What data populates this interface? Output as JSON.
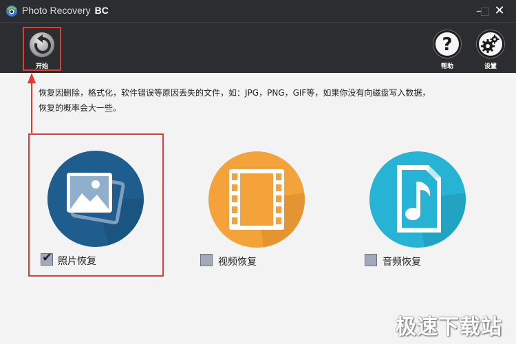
{
  "window": {
    "title": "Photo Recovery",
    "title_suffix": "BC",
    "minimize": "–",
    "maximize": "□",
    "close": "✕"
  },
  "toolbar": {
    "start_label": "开始",
    "help_label": "帮助",
    "settings_label": "设置"
  },
  "description": {
    "line1": "恢复因删除，格式化，软件错误等原因丢失的文件，如：JPG，PNG，GIF等，如果你没有向磁盘写入数据，",
    "line2": "恢复的概率会大一些。"
  },
  "categories": [
    {
      "label": "照片恢复",
      "checked": true,
      "icon": "photo-icon",
      "color": "#1e5d8e"
    },
    {
      "label": "视频恢复",
      "checked": false,
      "icon": "film-icon",
      "color": "#f3a33a"
    },
    {
      "label": "音频恢复",
      "checked": false,
      "icon": "music-file-icon",
      "color": "#26b3d4"
    }
  ],
  "watermark": "极速下载站",
  "colors": {
    "titlebar": "#2b2d30",
    "highlight": "#e23a35",
    "background": "#f3f3f3"
  }
}
